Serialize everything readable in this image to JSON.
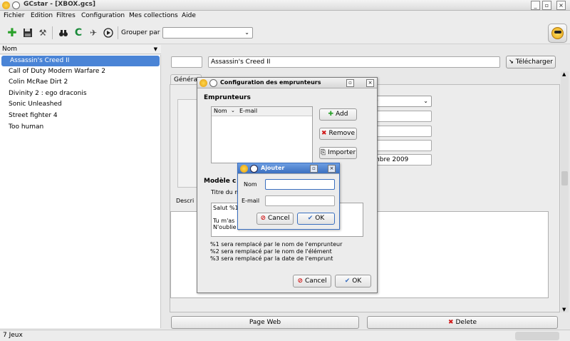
{
  "window": {
    "title": "GCstar - [XBOX.gcs]",
    "btn_min": "_",
    "btn_max": "▫",
    "btn_close": "×"
  },
  "menu": [
    "Fichier",
    "Edition",
    "Filtres",
    "Configuration",
    "Mes collections",
    "Aide"
  ],
  "toolbar": {
    "group_label": "Grouper par",
    "group_value": "",
    "icons": [
      "add-icon",
      "save-icon",
      "settings-icon",
      "binoculars-icon",
      "refresh-icon",
      "random-icon",
      "play-icon"
    ]
  },
  "list": {
    "header": "Nom",
    "items": [
      "Assassin's Creed II",
      "Call of Duty Modern Warfare 2",
      "Colin McRae Dirt 2",
      "Divinity 2 : ego draconis",
      "Sonic Unleashed",
      "Street fighter 4",
      "Too human"
    ],
    "selected_index": 0
  },
  "item": {
    "id_value": "",
    "title": "Assassin's Creed II",
    "download_button": "Télécharger",
    "tab_general": "Généra",
    "combo_value": "0",
    "date_partial": "mbre 2009",
    "description_label": "Descri",
    "model_section_partial": "Modèle c",
    "title_partial": "Titre du m",
    "web_button": "Page Web",
    "delete_button": "Delete"
  },
  "borrowers_dialog": {
    "title": "Configuration des emprunteurs",
    "section": "Emprunteurs",
    "columns": [
      "Nom",
      "E-mail"
    ],
    "add_button": "Add",
    "remove_button": "Remove",
    "import_button": "Importer",
    "template_text_1": "Salut %1",
    "template_text_2": "Tu m'as",
    "template_text_3": "N'oublie pas de me le ramener !",
    "legend": [
      "%1 sera remplacé par le nom de l'emprunteur",
      "%2 sera remplacé par le nom de l'élément",
      "%3 sera remplacé par la date de l'emprunt"
    ],
    "cancel_button": "Cancel",
    "ok_button": "OK"
  },
  "add_dialog": {
    "title": "Ajouter",
    "name_label": "Nom",
    "email_label": "E-mail",
    "name_value": "",
    "email_value": "",
    "cancel_button": "Cancel",
    "ok_button": "OK"
  },
  "status": {
    "count": "7 Jeux"
  }
}
